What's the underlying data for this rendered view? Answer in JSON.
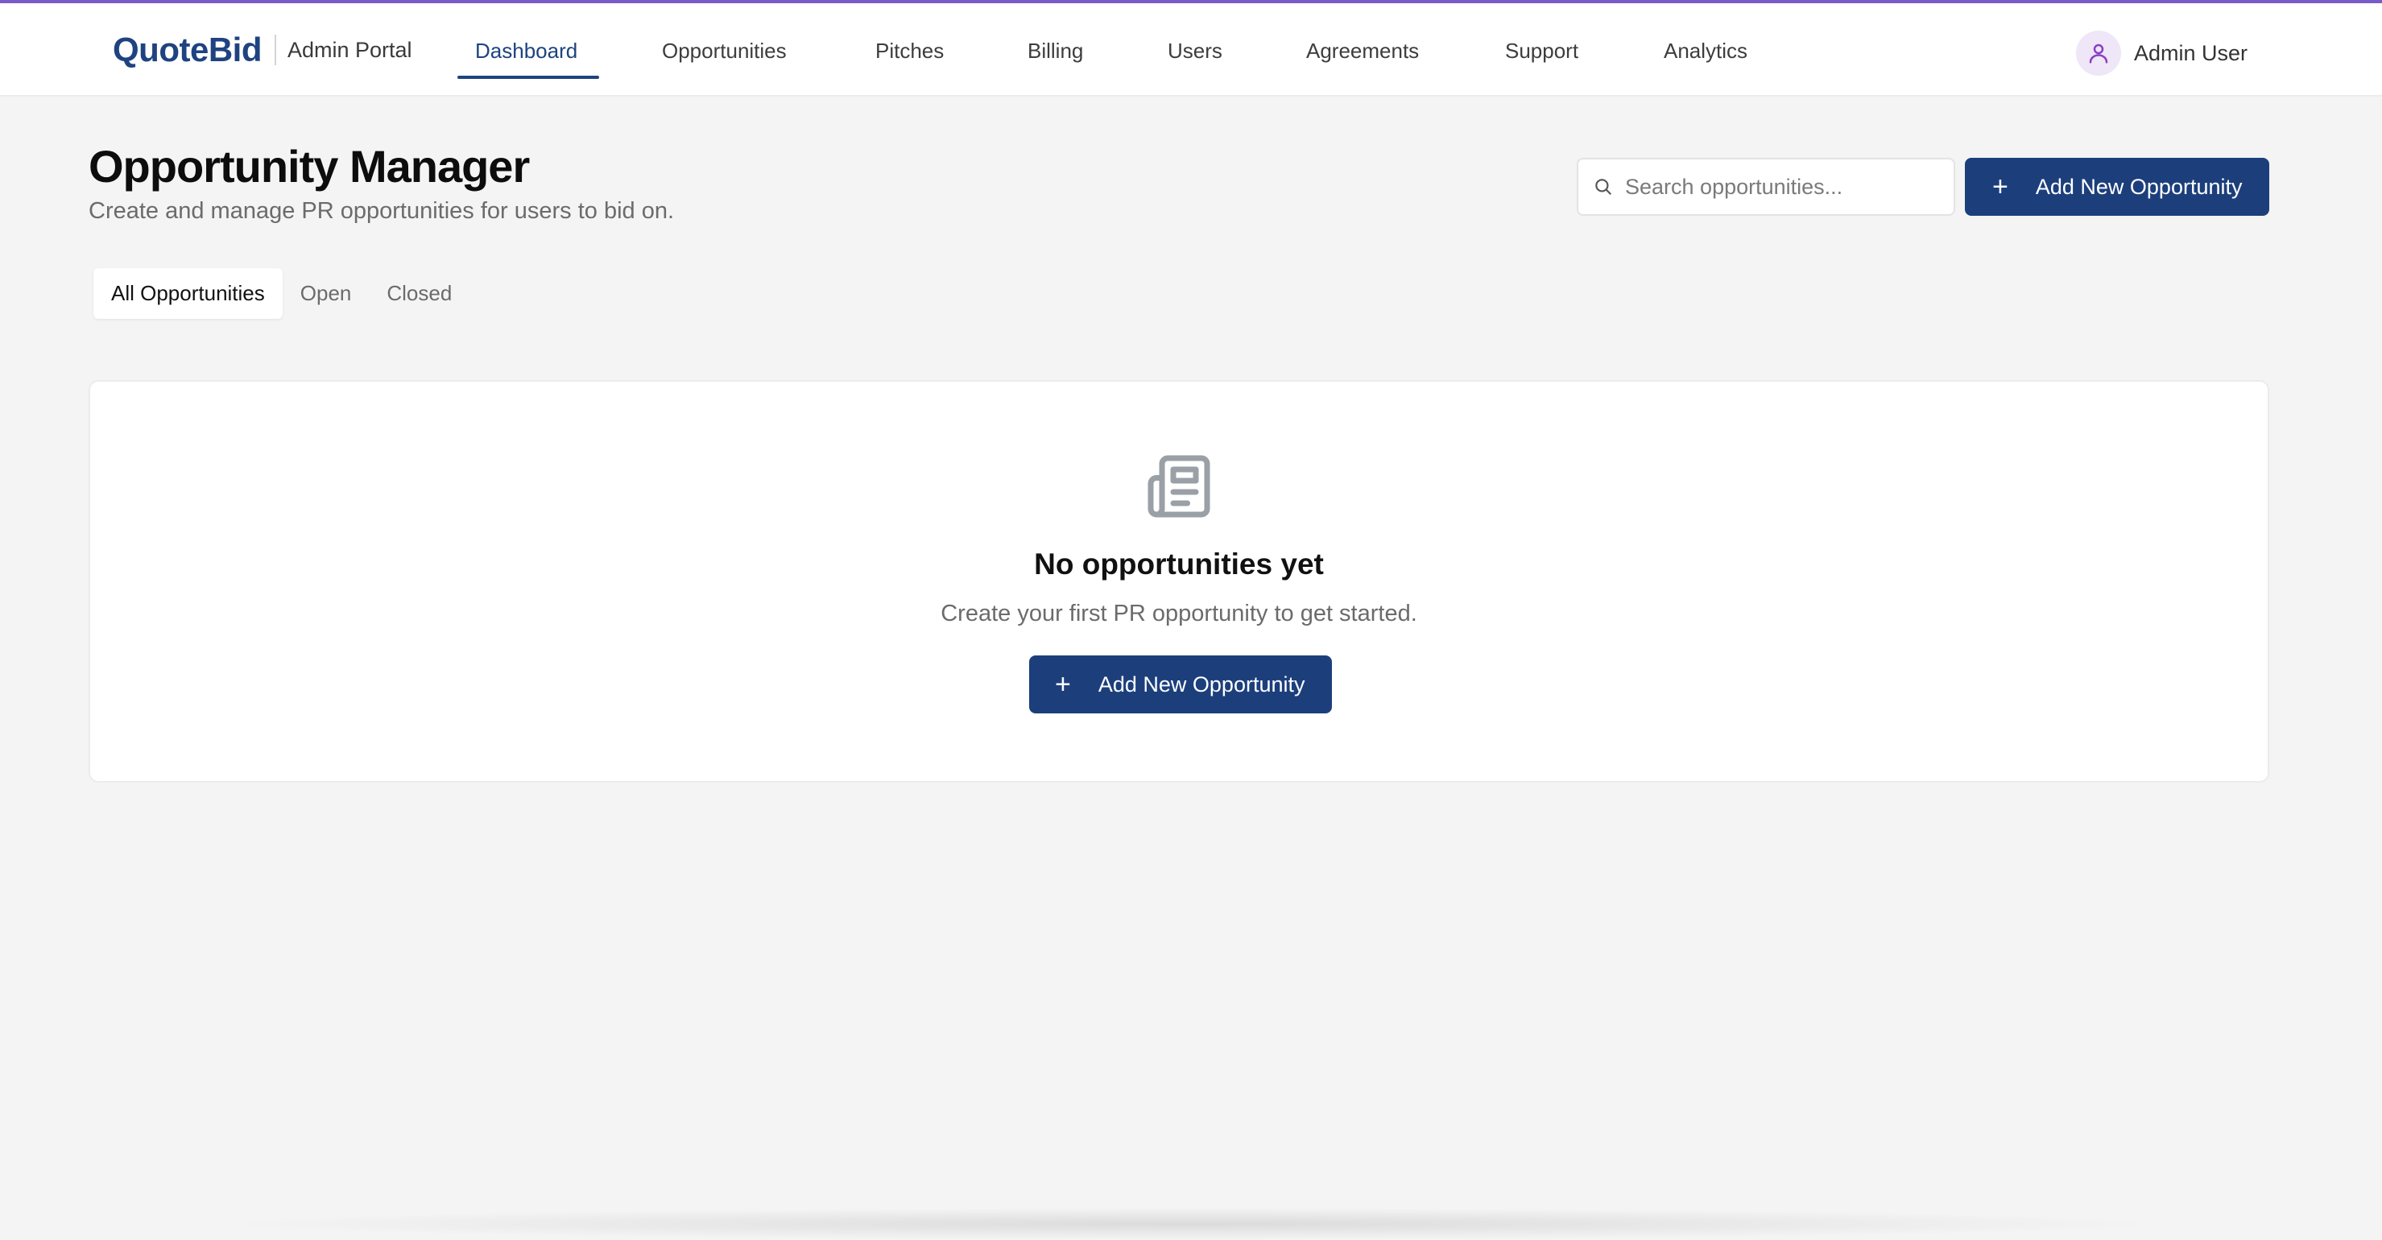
{
  "header": {
    "logo": "QuoteBid",
    "portal_label": "Admin Portal",
    "nav": [
      {
        "label": "Dashboard",
        "active": true
      },
      {
        "label": "Opportunities",
        "active": false
      },
      {
        "label": "Pitches",
        "active": false
      },
      {
        "label": "Billing",
        "active": false
      },
      {
        "label": "Users",
        "active": false
      },
      {
        "label": "Agreements",
        "active": false
      },
      {
        "label": "Support",
        "active": false
      },
      {
        "label": "Analytics",
        "active": false
      }
    ],
    "user_name": "Admin User",
    "user_icon": "user-icon"
  },
  "page": {
    "title": "Opportunity Manager",
    "subtitle": "Create and manage PR opportunities for users to bid on.",
    "search_placeholder": "Search opportunities...",
    "search_value": "",
    "add_button_label": "Add New Opportunity"
  },
  "tabs": [
    {
      "label": "All Opportunities",
      "active": true
    },
    {
      "label": "Open",
      "active": false
    },
    {
      "label": "Closed",
      "active": false
    }
  ],
  "empty_state": {
    "icon": "newspaper-icon",
    "title": "No opportunities yet",
    "description": "Create your first PR opportunity to get started.",
    "button_label": "Add New Opportunity"
  },
  "colors": {
    "brand": "#1e4380",
    "primary_button": "#1c3f7c",
    "accent_top_border": "#7a5ac8",
    "avatar_bg": "#efe6f8",
    "background": "#f4f4f4"
  }
}
